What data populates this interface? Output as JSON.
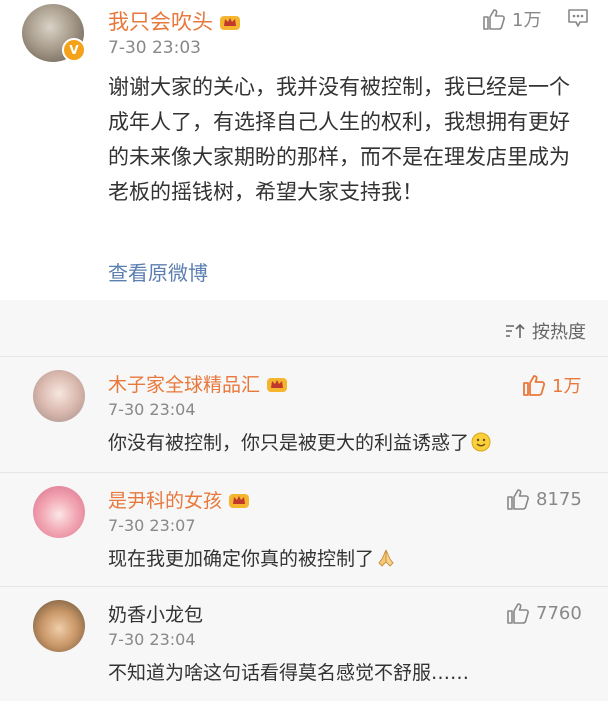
{
  "post": {
    "author": "我只会吹头",
    "verified_badge": "V",
    "timestamp": "7-30 23:03",
    "like_count": "1万",
    "text": "谢谢大家的关心，我并没有被控制，我已经是一个成年人了，有选择自己人生的权利，我想拥有更好的未来像大家期盼的那样，而不是在理发店里成为老板的摇钱树，希望大家支持我！",
    "view_original_label": "查看原微博"
  },
  "sort": {
    "label": "按热度",
    "icon": "sort-icon"
  },
  "comments": [
    {
      "author": "木子家全球精品汇",
      "timestamp": "7-30 23:04",
      "text": "你没有被控制，你只是被更大的利益诱惑了",
      "like_count": "1万",
      "liked": true,
      "emoji": "smiley"
    },
    {
      "author": "是尹科的女孩",
      "timestamp": "7-30 23:07",
      "text": "现在我更加确定你真的被控制了",
      "like_count": "8175",
      "liked": false,
      "emoji": "praying-hands"
    },
    {
      "author": "奶香小龙包",
      "timestamp": "7-30 23:04",
      "text": "不知道为啥这句话看得莫名感觉不舒服……",
      "like_count": "7760",
      "liked": false,
      "emoji": ""
    }
  ],
  "colors": {
    "name_accent": "#e8783c",
    "link": "#5b7fb0",
    "muted": "#888888",
    "comments_bg": "#f7f7f7"
  }
}
